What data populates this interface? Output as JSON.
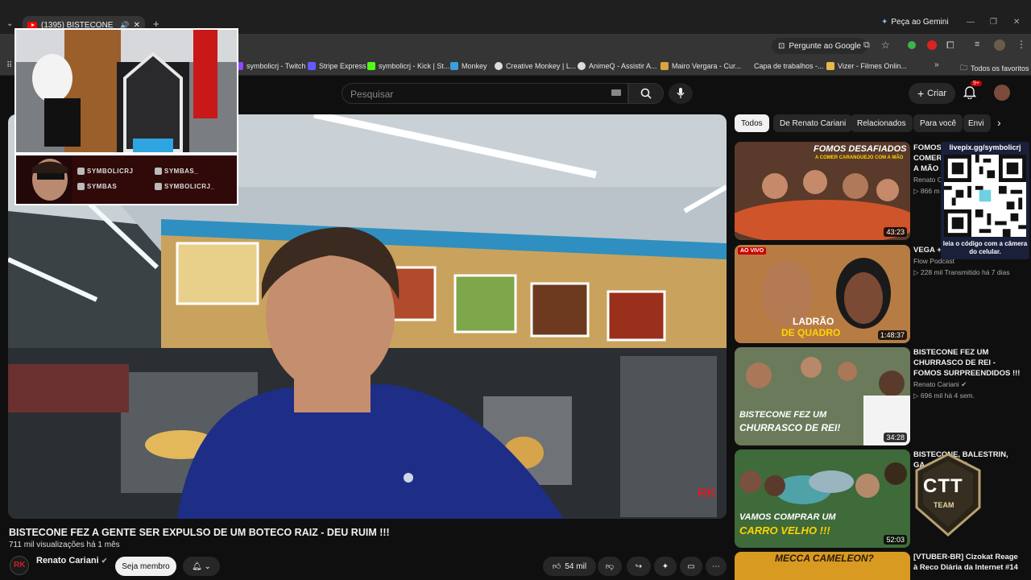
{
  "browser": {
    "tab_title": "(1395) BISTECONE FEZ A G",
    "gemini_label": "Peça ao Gemini",
    "google_label": "Pergunte ao Google",
    "bookmarks": [
      "symbolicrj - Twitch",
      "Stripe Express",
      "symbolicrj - Kick | St...",
      "Monkey",
      "Creative Monkey | L...",
      "AnimeQ - Assistir A...",
      "Mairo Vergara - Cur...",
      "Capa de trabalhos -...",
      "Vizer - Filmes Onlin..."
    ],
    "all_bookmarks": "Todos os favoritos"
  },
  "youtube": {
    "search_placeholder": "Pesquisar",
    "create_label": "Criar",
    "notifications_badge": "9+"
  },
  "overlay": {
    "socials": [
      "SYMBOLICRJ",
      "SYMBAS_",
      "SYMBAS",
      "SYMBOLICRJ_"
    ],
    "qr_title": "livepix.gg/symbolicrj",
    "qr_caption": "leia o código com a câmera do celular."
  },
  "chips": [
    "Todos",
    "De Renato Cariani",
    "Relacionados",
    "Para você",
    "Envi"
  ],
  "recommendations": [
    {
      "title": "FOMOS COMER A MÃO",
      "channel": "Renato C",
      "meta": "866 m",
      "duration": "43:23",
      "thumb_text": "FOMOS DESAFIADOS",
      "thumb_sub": "A COMER CARANGUEJO COM A MÃO"
    },
    {
      "title": "VEGA +",
      "channel": "Flow Podcast",
      "meta": "228 mil   Transmitido há 7 dias",
      "duration": "1:48:37",
      "live": "AO VIVO",
      "thumb_text": "LADRÃO",
      "thumb_sub": "DE QUADRO"
    },
    {
      "title": "BISTECONE FEZ UM CHURRASCO DE REI - FOMOS SURPREENDIDOS !!!",
      "channel": "Renato Cariani",
      "meta": "696 mil   há 4 sem.",
      "duration": "34:28",
      "thumb_text": "BISTECONE FEZ UM",
      "thumb_sub": "CHURRASCO DE REI!"
    },
    {
      "title": "BISTECONE, BALESTRIN, GA... RO VELH...",
      "channel": "",
      "meta": "",
      "duration": "52:03",
      "thumb_text": "VAMOS COMPRAR UM",
      "thumb_sub": "CARRO VELHO !!!"
    },
    {
      "title": "[VTUBER-BR] Cizokat Reage à Reco Diária da Internet #14",
      "channel": "",
      "meta": "",
      "duration": "",
      "thumb_text": "MECCA CAMELEON?",
      "thumb_sub": ""
    }
  ],
  "ctt_logo": "CTT TEAM",
  "video": {
    "title": "BISTECONE FEZ A GENTE SER EXPULSO DE UM BOTECO RAIZ - DEU RUIM !!!",
    "views": "711 mil visualizações  há 1 mês",
    "channel": "Renato Cariani",
    "join_label": "Seja membro",
    "likes": "54 mil",
    "watermark": "RK"
  }
}
